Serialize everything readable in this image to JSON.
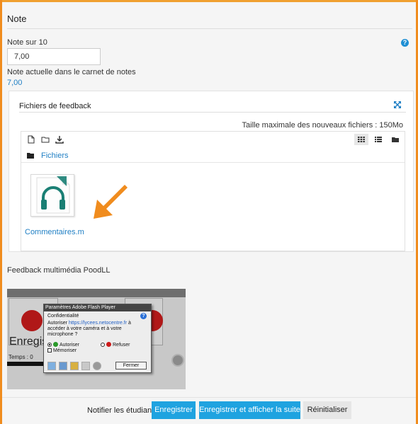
{
  "section": {
    "title": "Note"
  },
  "grade": {
    "label": "Note sur 10",
    "value": "7,00",
    "current_label": "Note actuelle dans le carnet de notes",
    "current_value": "7,00"
  },
  "feedback_files": {
    "title": "Fichiers de feedback",
    "max_size": "Taille maximale des nouveaux fichiers : 150Mo",
    "breadcrumb": "Fichiers",
    "file": {
      "name": "Commentaires.m",
      "icon": "headphones-icon"
    }
  },
  "poodll": {
    "label": "Feedback multimédia PoodLL",
    "recorder_text": "Enregis",
    "time_label": "Temps :",
    "time_value": "0",
    "dialog": {
      "title": "Paramètres Adobe Flash Player",
      "subtitle": "Confidentialité",
      "message_before": "Autoriser ",
      "message_url": "https://lycees.netocentre.fr",
      "message_after": " à accéder à votre caméra et à votre microphone ?",
      "allow": "Autoriser",
      "deny": "Refuser",
      "remember": "Mémoriser",
      "close": "Fermer"
    }
  },
  "footer": {
    "notify_label": "Notifier les étudiants",
    "notify_checked": true,
    "save": "Enregistrer",
    "save_next": "Enregistrer et afficher la suite",
    "reset": "Réinitialiser"
  },
  "colors": {
    "accent_orange": "#f08c1e",
    "primary_button": "#1fa3e0",
    "link": "#1f7fc4"
  }
}
